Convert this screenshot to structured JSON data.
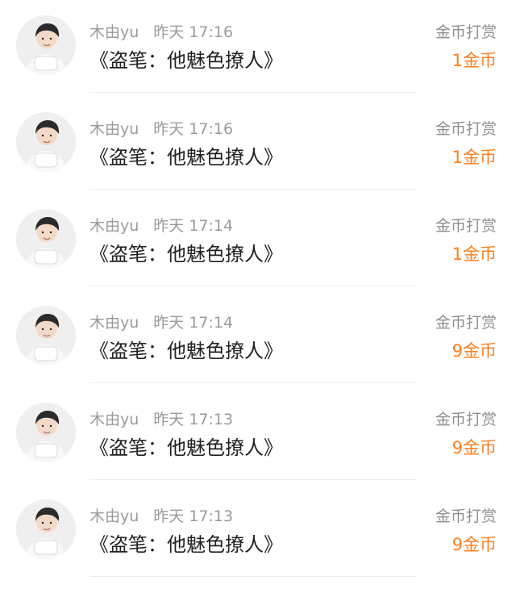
{
  "items": [
    {
      "username": "木由yu",
      "time": "昨天 17:16",
      "title": "《盗笔：他魅色撩人》",
      "action": "金币打赏",
      "amount": "1金币"
    },
    {
      "username": "木由yu",
      "time": "昨天 17:16",
      "title": "《盗笔：他魅色撩人》",
      "action": "金币打赏",
      "amount": "1金币"
    },
    {
      "username": "木由yu",
      "time": "昨天 17:14",
      "title": "《盗笔：他魅色撩人》",
      "action": "金币打赏",
      "amount": "1金币"
    },
    {
      "username": "木由yu",
      "time": "昨天 17:14",
      "title": "《盗笔：他魅色撩人》",
      "action": "金币打赏",
      "amount": "9金币"
    },
    {
      "username": "木由yu",
      "time": "昨天 17:13",
      "title": "《盗笔：他魅色撩人》",
      "action": "金币打赏",
      "amount": "9金币"
    },
    {
      "username": "木由yu",
      "time": "昨天 17:13",
      "title": "《盗笔：他魅色撩人》",
      "action": "金币打赏",
      "amount": "9金币"
    }
  ],
  "colors": {
    "accent": "#ff7f20",
    "meta": "#9a9a9a",
    "title": "#222222",
    "divider": "#ececec"
  }
}
